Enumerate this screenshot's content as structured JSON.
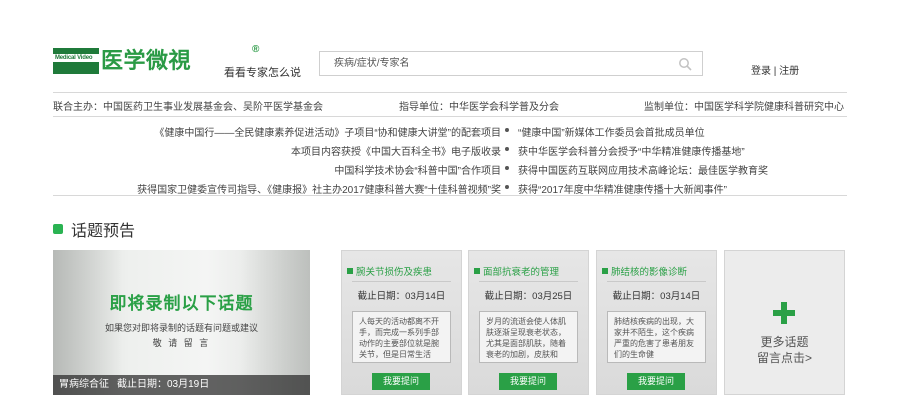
{
  "header": {
    "logo_box_text": "Medical Video",
    "logo_text": "医学微視",
    "logo_reg": "®",
    "tagline": "看看专家怎么说",
    "search": {
      "placeholder": "疾病/症状/专家名",
      "icon": "search-icon"
    },
    "auth": {
      "login": "登录",
      "divider": "|",
      "register": "注册"
    }
  },
  "sponsors": {
    "organizers": "联合主办：中国医药卫生事业发展基金会、吴阶平医学基金会",
    "guidance": "指导单位：中华医学会科学普及分会",
    "supervision": "监制单位：中国医学科学院健康科普研究中心"
  },
  "honors": [
    {
      "left": "《健康中国行——全民健康素养促进活动》子项目“协和健康大讲堂”的配套项目",
      "right": "“健康中国”新媒体工作委员会首批成员单位"
    },
    {
      "left": "本项目内容获授《中国大百科全书》电子版收录",
      "right": "获中华医学会科普分会授予“中华精准健康传播基地”"
    },
    {
      "left": "中国科学技术协会“科普中国”合作项目",
      "right": "获得中国医药互联网应用技术高峰论坛：最佳医学教育奖"
    },
    {
      "left": "获得国家卫健委宣传司指导、《健康报》社主办2017健康科普大赛“十佳科普视频”奖",
      "right": "获得“2017年度中华精准健康传播十大新闻事件”"
    }
  ],
  "section": {
    "title": "话题预告"
  },
  "feature": {
    "headline": "即将录制以下话题",
    "sub1": "如果您对即将录制的话题有问题或建议",
    "sub2": "敬 请 留 言",
    "topic": "胃病综合征",
    "deadline": "截止日期：03月19日"
  },
  "cards": [
    {
      "title": "腕关节损伤及疾患",
      "date": "截止日期：03月14日",
      "desc": "人每天的活动都离不开手，而完成一系列手部动作的主要部位就是腕关节，但是日常生活",
      "button": "我要提问"
    },
    {
      "title": "面部抗衰老的管理",
      "date": "截止日期：03月25日",
      "desc": "岁月的流逝会使人体肌肤逐渐呈现衰老状态，尤其是面部肌肤，随着衰老的加剧，皮肤和",
      "button": "我要提问"
    },
    {
      "title": "肺结核的影像诊断",
      "date": "截止日期：03月14日",
      "desc": "肺结核疾病的出现，大家并不陌生，这个疾病严重的危害了患者朋友们的生命健",
      "button": "我要提问"
    }
  ],
  "more": {
    "line1": "更多话题",
    "line2": "留言点击>"
  },
  "colors": {
    "brand_green": "#2aa046",
    "logo_dark_green": "#1f7a3a"
  }
}
